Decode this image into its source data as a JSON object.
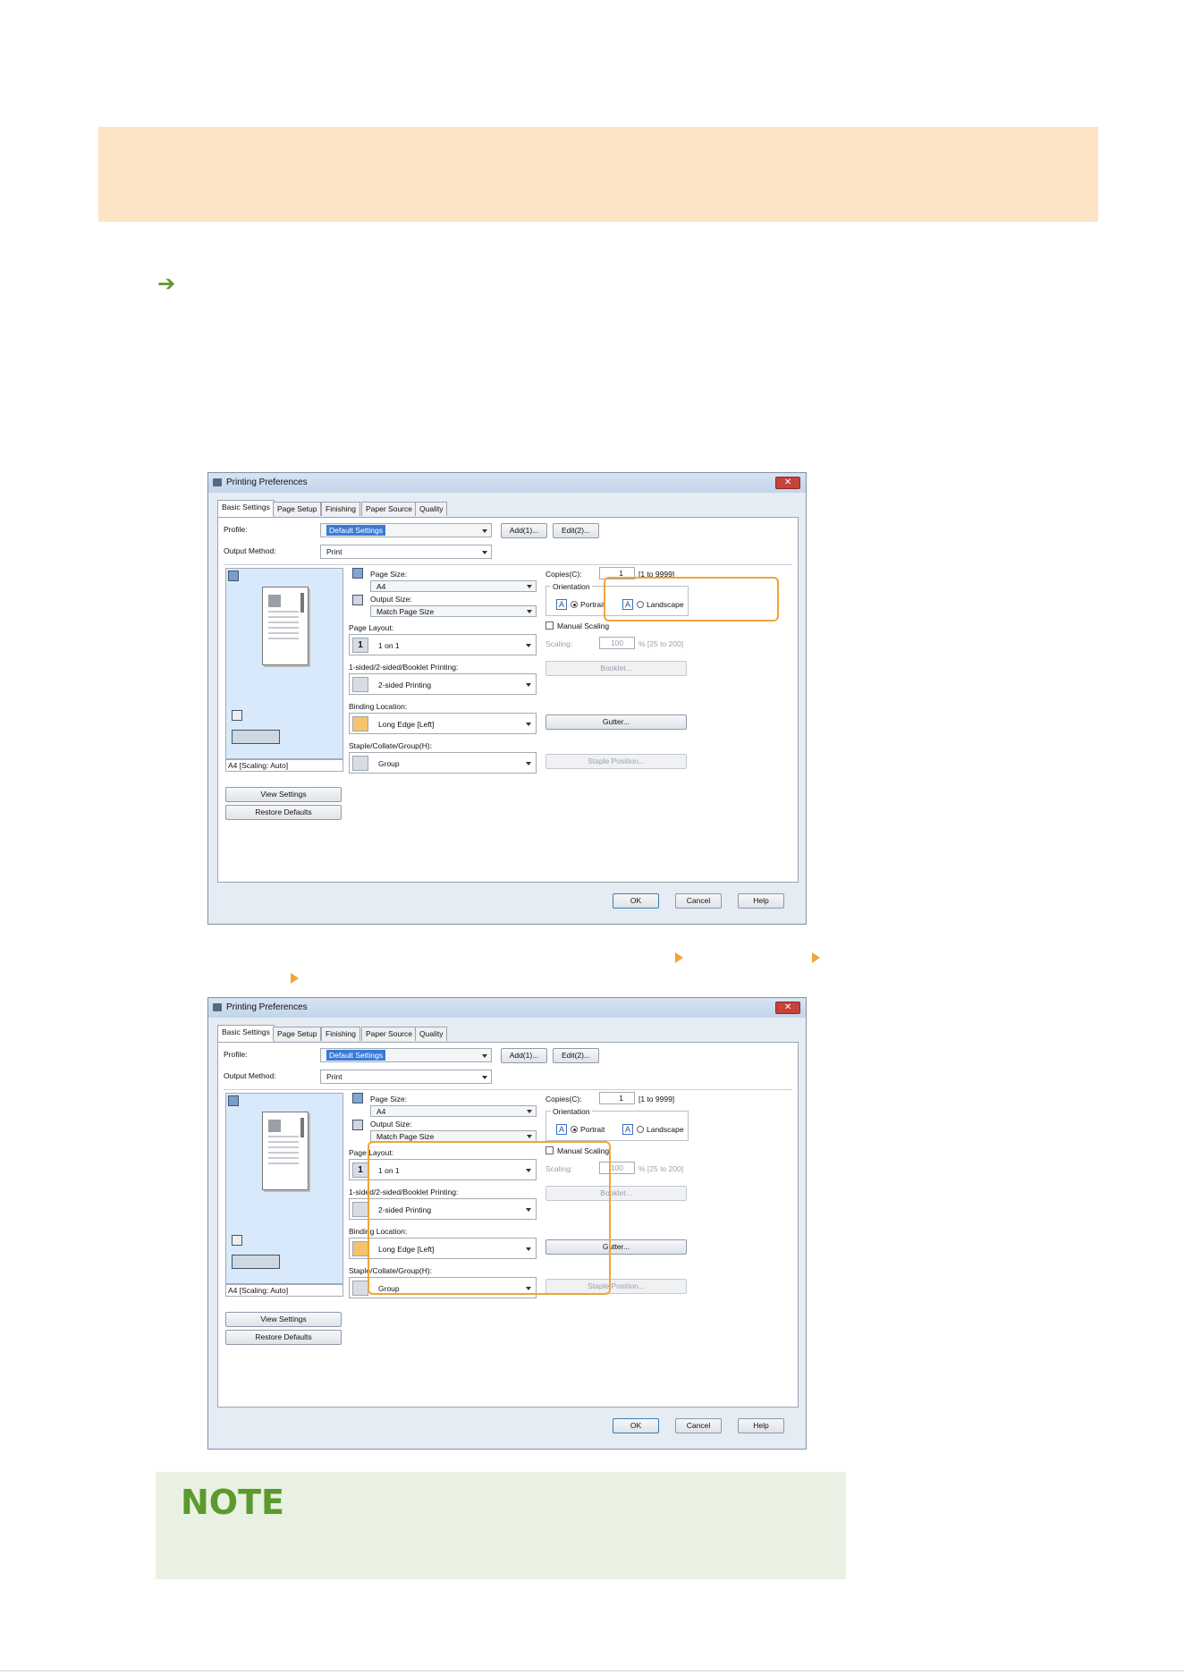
{
  "page": {
    "arrow_glyph": "➔",
    "note_title": "NOTE"
  },
  "dialogs": [
    {
      "title": "Printing Preferences",
      "close": "✕",
      "tabs": [
        "Basic Settings",
        "Page Setup",
        "Finishing",
        "Paper Source",
        "Quality"
      ],
      "profile_label": "Profile:",
      "profile_value": "Default Settings",
      "add_button": "Add(1)...",
      "edit_button": "Edit(2)...",
      "output_method_label": "Output Method:",
      "output_method_value": "Print",
      "page_size_label": "Page Size:",
      "page_size_value": "A4",
      "output_size_label": "Output Size:",
      "output_size_value": "Match Page Size",
      "copies_label": "Copies(C):",
      "copies_value": "1",
      "copies_range": "[1 to 9999]",
      "orientation_label": "Orientation",
      "portrait_label": "Portrait",
      "landscape_label": "Landscape",
      "manual_scaling_label": "Manual Scaling",
      "scaling_label": "Scaling:",
      "scaling_value": "100",
      "scaling_range": "% [25 to 200]",
      "page_layout_label": "Page Layout:",
      "page_layout_value": "1 on 1",
      "page_layout_icon": "1",
      "sided_label": "1-sided/2-sided/Booklet Printing:",
      "sided_value": "2-sided Printing",
      "booklet_button": "Booklet...",
      "binding_label": "Binding Location:",
      "binding_value": "Long Edge [Left]",
      "gutter_button": "Gutter...",
      "staple_label": "Staple/Collate/Group(H):",
      "staple_value": "Group",
      "staple_position_button": "Staple Position...",
      "preview_status": "A4 [Scaling: Auto]",
      "view_settings_button": "View Settings",
      "restore_defaults_button": "Restore Defaults",
      "ok_button": "OK",
      "cancel_button": "Cancel",
      "help_button": "Help"
    },
    {
      "title": "Printing Preferences",
      "close": "✕",
      "tabs": [
        "Basic Settings",
        "Page Setup",
        "Finishing",
        "Paper Source",
        "Quality"
      ],
      "profile_label": "Profile:",
      "profile_value": "Default Settings",
      "add_button": "Add(1)...",
      "edit_button": "Edit(2)...",
      "output_method_label": "Output Method:",
      "output_method_value": "Print",
      "page_size_label": "Page Size:",
      "page_size_value": "A4",
      "output_size_label": "Output Size:",
      "output_size_value": "Match Page Size",
      "copies_label": "Copies(C):",
      "copies_value": "1",
      "copies_range": "[1 to 9999]",
      "orientation_label": "Orientation",
      "portrait_label": "Portrait",
      "landscape_label": "Landscape",
      "manual_scaling_label": "Manual Scaling",
      "scaling_label": "Scaling:",
      "scaling_value": "100",
      "scaling_range": "% [25 to 200]",
      "page_layout_label": "Page Layout:",
      "page_layout_value": "1 on 1",
      "page_layout_icon": "1",
      "sided_label": "1-sided/2-sided/Booklet Printing:",
      "sided_value": "2-sided Printing",
      "booklet_button": "Booklet...",
      "binding_label": "Binding Location:",
      "binding_value": "Long Edge [Left]",
      "gutter_button": "Gutter...",
      "staple_label": "Staple/Collate/Group(H):",
      "staple_value": "Group",
      "staple_position_button": "Staple Position...",
      "preview_status": "A4 [Scaling: Auto]",
      "view_settings_button": "View Settings",
      "restore_defaults_button": "Restore Defaults",
      "ok_button": "OK",
      "cancel_button": "Cancel",
      "help_button": "Help"
    }
  ],
  "colors": {
    "banner": "#fde4c4",
    "highlight": "#f2a33a",
    "note_bg": "#e9f1e3",
    "note_title": "#5b9a2c"
  }
}
